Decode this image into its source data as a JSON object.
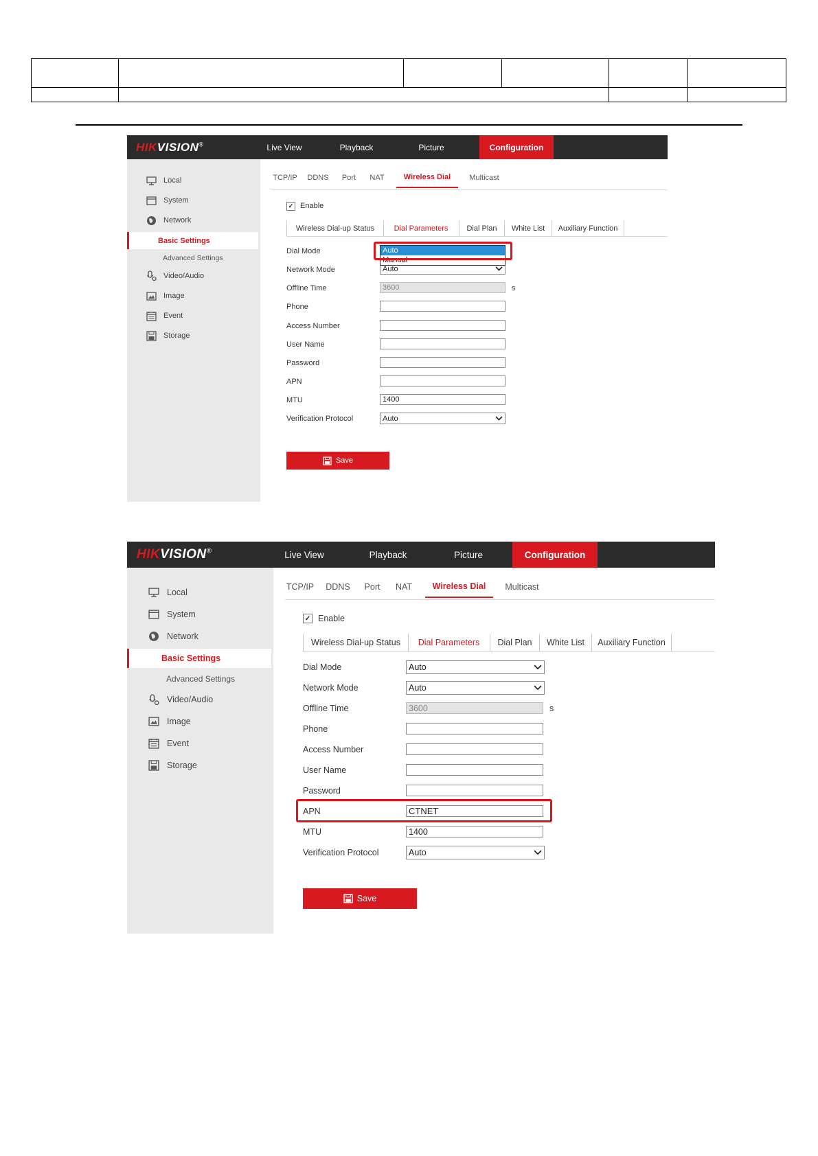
{
  "header": {
    "logo_main": "HIK",
    "logo_rest": "VISION",
    "logo_reg": "®"
  },
  "nav": {
    "items": [
      "Live View",
      "Playback",
      "Picture",
      "Configuration"
    ],
    "active": "Configuration"
  },
  "sidebar": {
    "items": [
      {
        "label": "Local",
        "icon": "monitor-icon"
      },
      {
        "label": "System",
        "icon": "system-icon"
      },
      {
        "label": "Network",
        "icon": "globe-icon"
      },
      {
        "label": "Basic Settings",
        "icon": ""
      },
      {
        "label": "Advanced Settings",
        "icon": ""
      },
      {
        "label": "Video/Audio",
        "icon": "microphone-icon"
      },
      {
        "label": "Image",
        "icon": "image-icon"
      },
      {
        "label": "Event",
        "icon": "calendar-icon"
      },
      {
        "label": "Storage",
        "icon": "storage-icon"
      }
    ],
    "active": "Basic Settings"
  },
  "tabs": {
    "items": [
      "TCP/IP",
      "DDNS",
      "Port",
      "NAT",
      "Wireless Dial",
      "Multicast"
    ],
    "active": "Wireless Dial"
  },
  "enable": {
    "label": "Enable",
    "checked": true,
    "mark": "✓"
  },
  "subtabs": {
    "items": [
      "Wireless Dial-up Status",
      "Dial Parameters",
      "Dial Plan",
      "White List",
      "Auxiliary Function"
    ],
    "active": "Dial Parameters"
  },
  "fields": {
    "dial_mode": {
      "label": "Dial Mode",
      "value": "Auto"
    },
    "network_mode": {
      "label": "Network Mode",
      "value": "Auto"
    },
    "offline_time": {
      "label": "Offline Time",
      "value": "3600",
      "unit": "s"
    },
    "phone": {
      "label": "Phone",
      "value": ""
    },
    "access_number": {
      "label": "Access Number",
      "value": ""
    },
    "user_name": {
      "label": "User Name",
      "value": ""
    },
    "password": {
      "label": "Password",
      "value": ""
    },
    "apn": {
      "label": "APN",
      "value": ""
    },
    "mtu": {
      "label": "MTU",
      "value": "1400"
    },
    "verification_protocol": {
      "label": "Verification Protocol",
      "value": "Auto"
    }
  },
  "dial_mode_dropdown": {
    "options": [
      "Auto",
      "Manual"
    ],
    "selected": "Auto"
  },
  "apn_filled_value": "CTNET",
  "save": {
    "label": "Save"
  },
  "colors": {
    "brand_red": "#d71920",
    "topbar": "#2b2b2b",
    "sidebar": "#e9e9e9",
    "highlight": "#e0151c",
    "dropdown_selected": "#2a8fd6"
  }
}
